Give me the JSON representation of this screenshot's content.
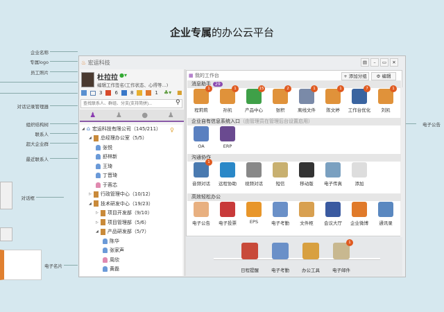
{
  "headline": {
    "bold": "企业专属",
    "rest": "的办公云平台"
  },
  "callouts_left": [
    "企业名称",
    "专属logo",
    "员工照片",
    "对话记录管理器",
    "组织结构树",
    "联系人",
    "超大企业群",
    "最近联系人",
    "对话框",
    "电子名片"
  ],
  "callouts_right": [
    "电子公告"
  ],
  "app": {
    "company": "宏运科技",
    "user": "杜拉拉",
    "signature": "编辑工作签名(工作状态、心得等...)",
    "counts": [
      "3",
      "6",
      "8",
      "1"
    ],
    "search_placeholder": "查找联系人、群组、分支(支持简拼)...",
    "tree": [
      {
        "label": "宏运科技有限公司（145/211）",
        "type": "company",
        "level": 0
      },
      {
        "label": "总经理办公室（5/5）",
        "type": "folder",
        "level": 1
      },
      {
        "label": "张悦",
        "type": "person",
        "level": 2
      },
      {
        "label": "舒林新",
        "type": "person",
        "level": 2
      },
      {
        "label": "王琦",
        "type": "person",
        "level": 2
      },
      {
        "label": "丁晋琦",
        "type": "person",
        "level": 2
      },
      {
        "label": "于蓉芯",
        "type": "female",
        "level": 2
      },
      {
        "label": "行政管理中心（10/12）",
        "type": "folder",
        "level": 1
      },
      {
        "label": "技术研发中心（19/23）",
        "type": "folder",
        "level": 1
      },
      {
        "label": "项目开发部（9/10）",
        "type": "folder",
        "level": 2
      },
      {
        "label": "项目管理部（5/6）",
        "type": "folder",
        "level": 2
      },
      {
        "label": "产品研发部（5/7）",
        "type": "folder",
        "level": 2
      },
      {
        "label": "陈华",
        "type": "person",
        "level": 3
      },
      {
        "label": "张家声",
        "type": "person",
        "level": 3
      },
      {
        "label": "周欣",
        "type": "female",
        "level": 3
      },
      {
        "label": "黄磊",
        "type": "person",
        "level": 3
      }
    ]
  },
  "workbench": {
    "title": "我的工作台",
    "add_group": "+ 添加分组",
    "edit": "⚙ 编辑",
    "sections": [
      {
        "title": "消息助手",
        "badge": "29",
        "items": [
          {
            "label": "程莉莉",
            "badge": "1",
            "color": "#e0923a"
          },
          {
            "label": "孙凯",
            "badge": "1",
            "color": "#e0923a"
          },
          {
            "label": "产品中心",
            "badge": "15",
            "color": "#3fa048"
          },
          {
            "label": "张积",
            "badge": "2",
            "color": "#e0923a"
          },
          {
            "label": "离线文件",
            "badge": "1",
            "color": "#7a8aa8"
          },
          {
            "label": "陈文婷",
            "badge": "1",
            "color": "#e0923a"
          },
          {
            "label": "工作台优化",
            "badge": "7",
            "color": "#3a64a0"
          },
          {
            "label": "刘凯",
            "badge": "1",
            "color": "#e0923a"
          }
        ]
      },
      {
        "title": "企业自有信息系统入口",
        "note": "（由管理员在管理后台设置启用）",
        "items": [
          {
            "label": "OA",
            "color": "#5a80c0"
          },
          {
            "label": "ERP",
            "color": "#6a4a90"
          }
        ]
      },
      {
        "title": "沟通协作",
        "items": [
          {
            "label": "音频对话",
            "badge": "1",
            "color": "#4a7ab0"
          },
          {
            "label": "远程协助",
            "color": "#2a88c8"
          },
          {
            "label": "视频对话",
            "color": "#888"
          },
          {
            "label": "短信",
            "color": "#c8b070"
          },
          {
            "label": "移动版",
            "color": "#333"
          },
          {
            "label": "电子传真",
            "color": "#7aa0c0"
          },
          {
            "label": "添加",
            "color": "#ddd"
          }
        ]
      },
      {
        "title": "高效轻松办公",
        "items": [
          {
            "label": "电子公告",
            "color": "#e8b080"
          },
          {
            "label": "电子投票",
            "color": "#c83a3a"
          },
          {
            "label": "EPS",
            "color": "#e8962a"
          },
          {
            "label": "电子考勤",
            "color": "#6a90c8"
          },
          {
            "label": "文件柜",
            "color": "#d8a050"
          },
          {
            "label": "会议大厅",
            "color": "#3a5aa0"
          },
          {
            "label": "企业微博",
            "color": "#e07a2a"
          },
          {
            "label": "通讯录",
            "color": "#5a88c0"
          }
        ]
      }
    ],
    "dock": [
      {
        "label": "日程提醒",
        "color": "#c84a3a"
      },
      {
        "label": "电子考勤",
        "color": "#6a90c8"
      },
      {
        "label": "办公工具",
        "color": "#d8a040"
      },
      {
        "label": "电子邮件",
        "badge": "1",
        "color": "#c8b890"
      }
    ]
  }
}
